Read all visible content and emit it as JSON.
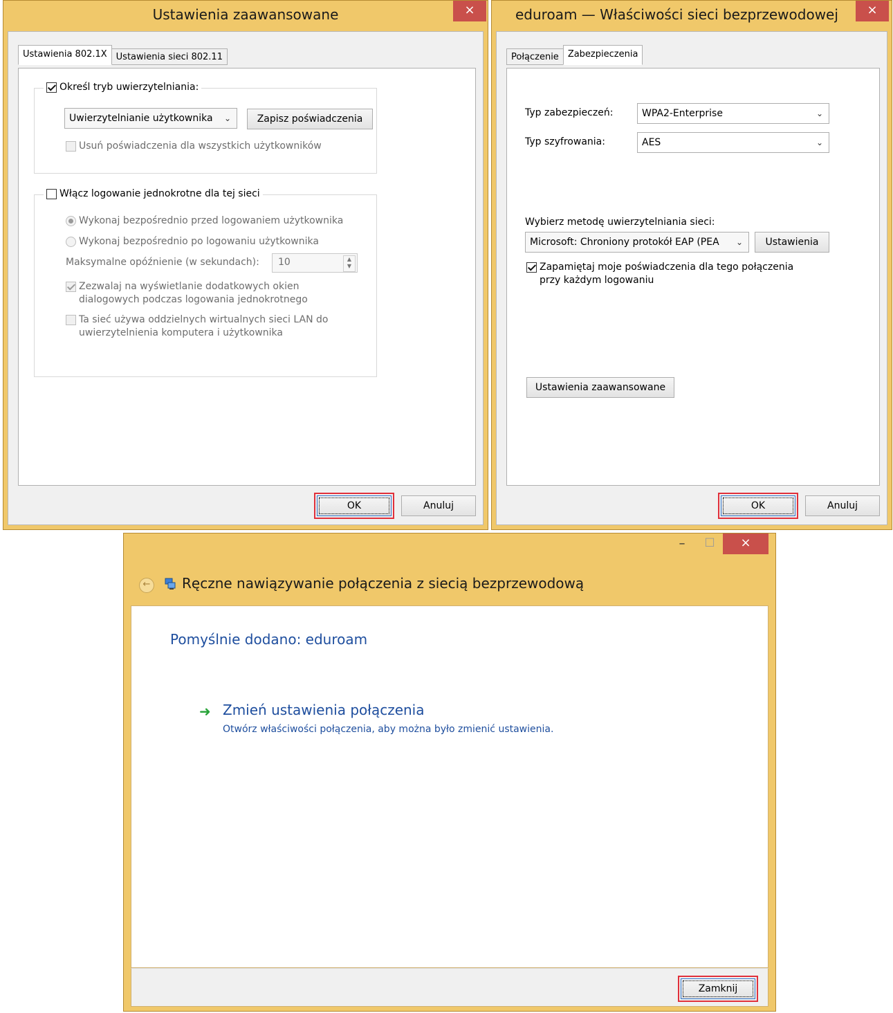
{
  "advanced_dialog": {
    "title": "Ustawienia zaawansowane",
    "close_glyph": "×",
    "tabs": [
      "Ustawienia 802.1X",
      "Ustawienia sieci 802.11"
    ],
    "auth_mode": {
      "checkbox_label": "Określ tryb uwierzytelniania:",
      "checked": true,
      "select_value": "Uwierzytelnianie użytkownika",
      "save_creds_button": "Zapisz poświadczenia",
      "delete_creds_label": "Usuń poświadczenia dla wszystkich użytkowników"
    },
    "sso": {
      "checkbox_label": "Włącz logowanie jednokrotne dla tej sieci",
      "checked": false,
      "radio_before": "Wykonaj bezpośrednio przed logowaniem użytkownika",
      "radio_after": "Wykonaj bezpośrednio po logowaniu użytkownika",
      "max_delay_label": "Maksymalne opóźnienie (w sekundach):",
      "max_delay_value": "10",
      "allow_dialogs_line1": "Zezwalaj na wyświetlanie dodatkowych okien",
      "allow_dialogs_line2": "dialogowych podczas logowania jednokrotnego",
      "vlan_line1": "Ta sieć używa oddzielnych wirtualnych sieci LAN do",
      "vlan_line2": "uwierzytelnienia komputera i użytkownika"
    },
    "ok_button": "OK",
    "cancel_button": "Anuluj"
  },
  "properties_dialog": {
    "title": "eduroam — Właściwości sieci bezprzewodowej",
    "close_glyph": "×",
    "tabs": [
      "Połączenie",
      "Zabezpieczenia"
    ],
    "security_type_label": "Typ zabezpieczeń:",
    "security_type_value": "WPA2-Enterprise",
    "encryption_type_label": "Typ szyfrowania:",
    "encryption_type_value": "AES",
    "auth_method_label": "Wybierz metodę uwierzytelniania sieci:",
    "auth_method_value": "Microsoft: Chroniony protokół EAP (PEA",
    "settings_button": "Ustawienia",
    "remember_line1": "Zapamiętaj moje poświadczenia dla tego połączenia",
    "remember_line2": "przy każdym logowaniu",
    "advanced_button": "Ustawienia zaawansowane",
    "ok_button": "OK",
    "cancel_button": "Anuluj"
  },
  "wizard": {
    "minimize_glyph": "–",
    "maximize_glyph": "□",
    "close_glyph": "×",
    "title": "Ręczne nawiązywanie połączenia z siecią bezprzewodową",
    "heading": "Pomyślnie dodano: eduroam",
    "link_title": "Zmień ustawienia połączenia",
    "link_desc": "Otwórz właściwości połączenia, aby można było zmienić ustawienia.",
    "close_button": "Zamknij"
  },
  "colors": {
    "frame": "#f0c86a",
    "close": "#c9504b",
    "heading_blue": "#1e4e9e",
    "link_blue": "#1e4e9e",
    "arrow_green": "#2aa43a"
  }
}
